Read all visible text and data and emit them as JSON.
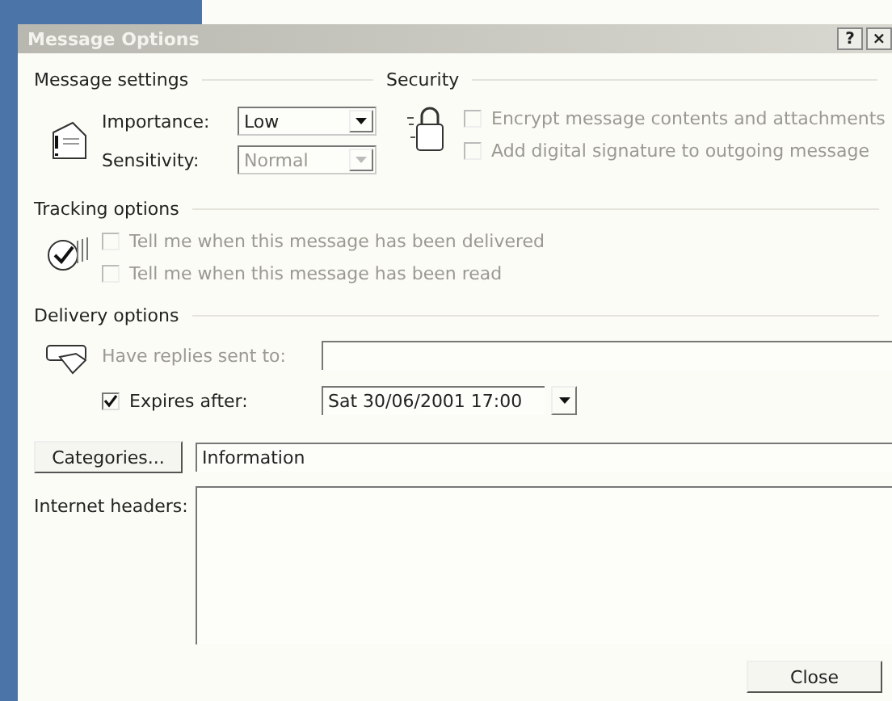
{
  "window": {
    "title": "Message Options",
    "buttons": [
      "?",
      "×"
    ]
  },
  "message_settings": {
    "title": "Message settings",
    "importance": {
      "label": "Importance:",
      "value": "Low",
      "disabled": false
    },
    "sensitivity": {
      "label": "Sensitivity:",
      "value": "Normal",
      "disabled": true
    }
  },
  "security": {
    "title": "Security",
    "options": [
      {
        "label": "Encrypt message contents and attachments",
        "checked": false,
        "disabled": true
      },
      {
        "label": "Add digital signature to outgoing message",
        "checked": false,
        "disabled": true
      }
    ]
  },
  "tracking_options": {
    "title": "Tracking options",
    "options": [
      {
        "label": "Tell me when this message has been delivered",
        "checked": false,
        "disabled": true
      },
      {
        "label": "Tell me when this message has been read",
        "checked": false,
        "disabled": true
      }
    ]
  },
  "delivery_options": {
    "title": "Delivery options",
    "replies": {
      "label": "Have replies sent to:",
      "disabled": true
    },
    "expires": {
      "label": "Expires after:",
      "checked": true,
      "disabled": false,
      "value": "Sat 30/06/2001 17:00"
    }
  },
  "categories": {
    "button": "Categories...",
    "value": "Information"
  },
  "internet_headers": {
    "label": "Internet headers:"
  },
  "buttons": [
    "Close"
  ]
}
